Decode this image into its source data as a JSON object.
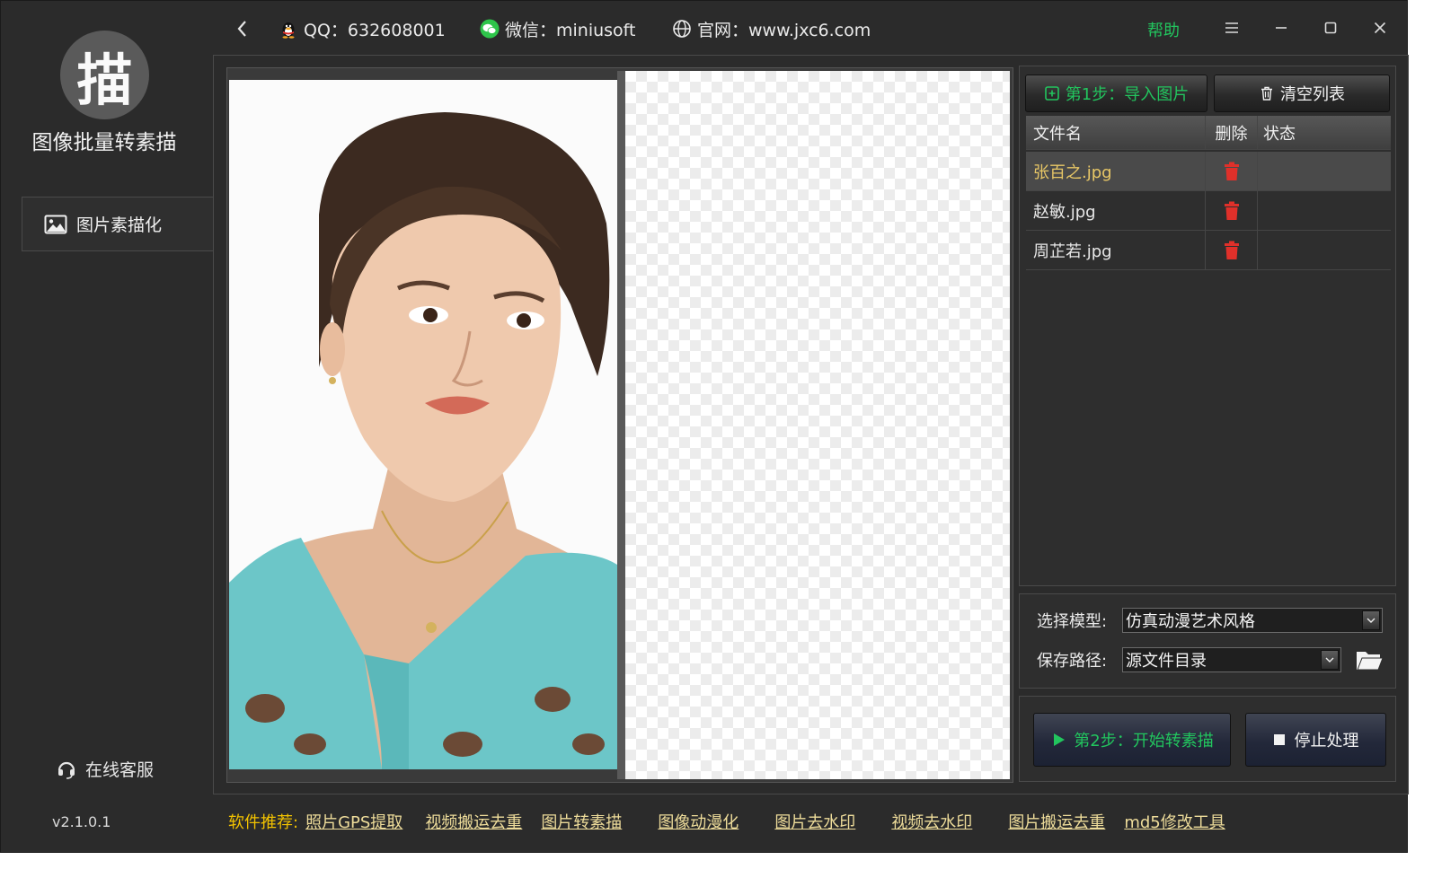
{
  "sidebar": {
    "logo_char": "描",
    "app_name": "图像批量转素描",
    "nav_item_label": "图片素描化",
    "service_label": "在线客服",
    "version": "v2.1.0.1"
  },
  "topbar": {
    "qq": "QQ：632608001",
    "wechat": "微信：miniusoft",
    "website": "官网：www.jxc6.com",
    "help": "帮助"
  },
  "file_panel": {
    "import_button": "第1步：导入图片",
    "clear_button": "清空列表",
    "columns": {
      "name": "文件名",
      "delete": "删除",
      "status": "状态"
    },
    "files": [
      {
        "name": "张百之.jpg",
        "status": "",
        "selected": true
      },
      {
        "name": "赵敏.jpg",
        "status": "",
        "selected": false
      },
      {
        "name": "周芷若.jpg",
        "status": "",
        "selected": false
      }
    ]
  },
  "settings": {
    "model_label": "选择模型:",
    "model_value": "仿真动漫艺术风格",
    "path_label": "保存路径:",
    "path_value": "源文件目录"
  },
  "actions": {
    "start_button": "第2步：开始转素描",
    "stop_button": "停止处理"
  },
  "footer": {
    "label": "软件推荐:",
    "links": [
      "照片GPS提取",
      "视频搬运去重",
      "图片转素描",
      "图像动漫化",
      "图片去水印",
      "视频去水印",
      "图片搬运去重",
      "md5修改工具"
    ]
  },
  "colors": {
    "accent_green": "#22c55e",
    "selected_file": "#e8c766",
    "delete_red": "#e0302a",
    "footer_label": "#f2c200",
    "footer_link": "#eedc9a"
  }
}
